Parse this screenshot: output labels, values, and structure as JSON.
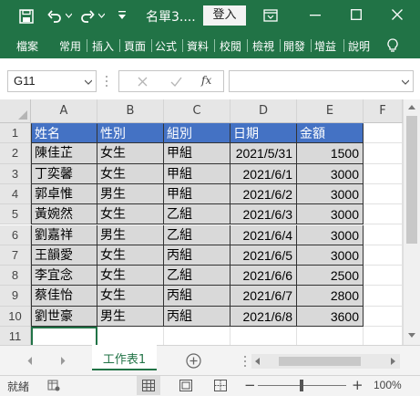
{
  "window": {
    "title": "名單3....",
    "login_label": "登入"
  },
  "ribbon": {
    "tabs": [
      "檔案",
      "常用",
      "插入",
      "頁面",
      "公式",
      "資料",
      "校閱",
      "檢視",
      "開發",
      "增益",
      "說明"
    ]
  },
  "formula_bar": {
    "name_box": "G11",
    "fx_label": "fx",
    "formula_value": ""
  },
  "sheet": {
    "columns": [
      "A",
      "B",
      "C",
      "D",
      "E",
      "F"
    ],
    "row_numbers": [
      "1",
      "2",
      "3",
      "4",
      "5",
      "6",
      "7",
      "8",
      "9",
      "10",
      "11"
    ],
    "header": [
      "姓名",
      "性別",
      "組別",
      "日期",
      "金額"
    ],
    "rows": [
      [
        "陳佳芷",
        "女生",
        "甲組",
        "2021/5/31",
        "1500"
      ],
      [
        "丁奕馨",
        "女生",
        "甲組",
        "2021/6/1",
        "3000"
      ],
      [
        "郭卓惟",
        "男生",
        "甲組",
        "2021/6/2",
        "3000"
      ],
      [
        "黃婉然",
        "女生",
        "乙組",
        "2021/6/3",
        "3000"
      ],
      [
        "劉嘉祥",
        "男生",
        "乙組",
        "2021/6/4",
        "3000"
      ],
      [
        "王韻愛",
        "女生",
        "丙組",
        "2021/6/5",
        "3000"
      ],
      [
        "李宜念",
        "女生",
        "乙組",
        "2021/6/6",
        "2500"
      ],
      [
        "蔡佳怡",
        "女生",
        "丙組",
        "2021/6/7",
        "2800"
      ],
      [
        "劉世豪",
        "男生",
        "丙組",
        "2021/6/8",
        "3600"
      ]
    ],
    "header_color": "#4472c4",
    "row_fill_color": "#d9d9d9"
  },
  "sheet_tabs": {
    "active_tab": "工作表1"
  },
  "status": {
    "ready_label": "就緒",
    "zoom_level": "100%",
    "zoom_minus": "−",
    "zoom_plus": "+"
  },
  "accent_color": "#217346"
}
